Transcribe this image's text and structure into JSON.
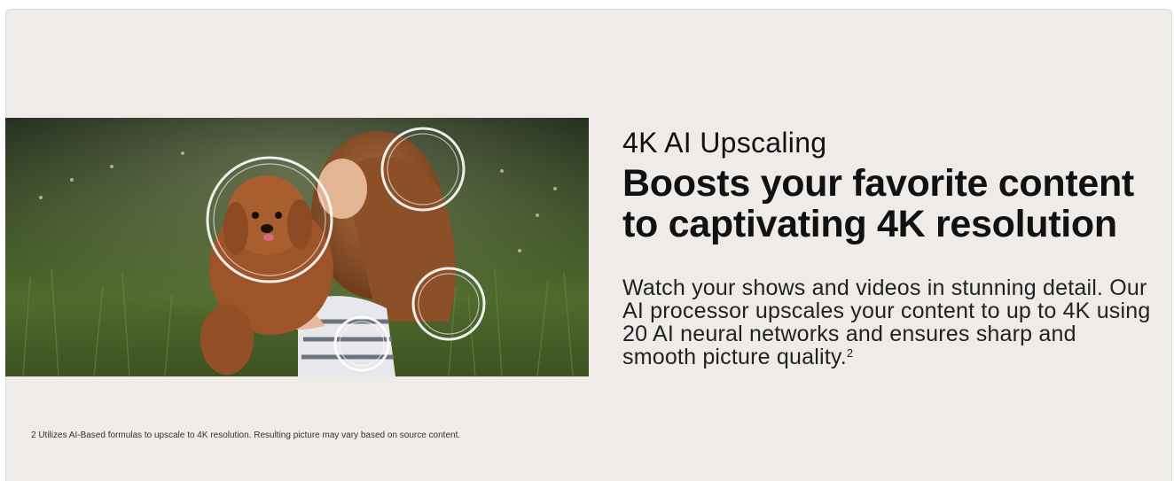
{
  "feature": {
    "eyebrow": "4K AI Upscaling",
    "headline_line1": "Boosts your favorite content",
    "headline_line2": "to captivating 4K resolution",
    "body": "Watch your shows and videos in stunning detail. Our AI processor upscales your content to up to 4K using 20 AI neural networks and ensures sharp and smooth picture quality.",
    "body_footnote_ref": "2",
    "footnote": "2 Utilizes AI-Based formulas to upscale to 4K resolution. Resulting picture may vary based on source content."
  },
  "image": {
    "subject": "girl-hugging-puppy-in-meadow",
    "highlight_rings": 4
  },
  "colors": {
    "panel_bg": "#eeebe8",
    "text": "#111111",
    "ring": "#ffffff"
  }
}
